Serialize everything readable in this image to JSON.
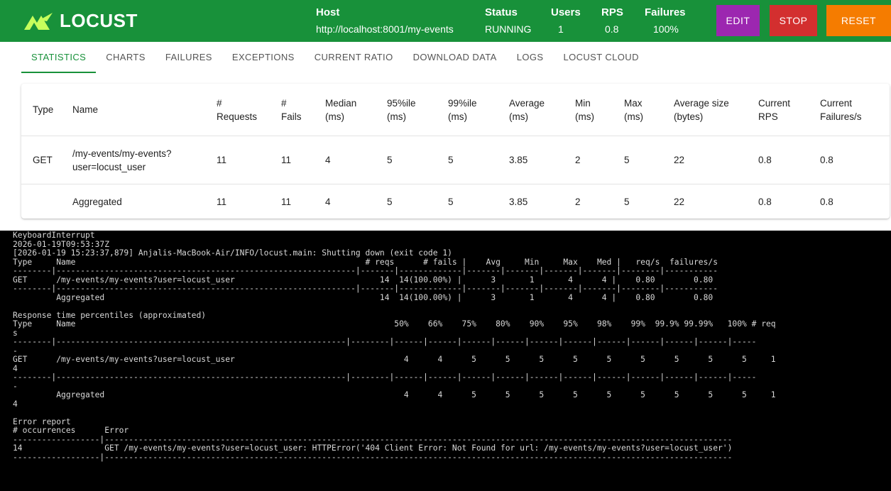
{
  "header": {
    "logo_text": "LOCUST",
    "stats": [
      {
        "label": "Host",
        "value": "http://localhost:8001/my-events"
      },
      {
        "label": "Status",
        "value": "RUNNING"
      },
      {
        "label": "Users",
        "value": "1"
      },
      {
        "label": "RPS",
        "value": "0.8"
      },
      {
        "label": "Failures",
        "value": "100%"
      }
    ],
    "buttons": {
      "edit": {
        "label": "EDIT",
        "color": "#9c27b0"
      },
      "stop": {
        "label": "STOP",
        "color": "#d32f2f"
      },
      "reset": {
        "label": "RESET",
        "color": "#f57c00"
      }
    },
    "brand_color": "#18913a"
  },
  "tabs": [
    {
      "label": "STATISTICS",
      "active": true
    },
    {
      "label": "CHARTS"
    },
    {
      "label": "FAILURES"
    },
    {
      "label": "EXCEPTIONS"
    },
    {
      "label": "CURRENT RATIO"
    },
    {
      "label": "DOWNLOAD DATA"
    },
    {
      "label": "LOGS"
    },
    {
      "label": "LOCUST CLOUD"
    }
  ],
  "stats_table": {
    "columns": [
      "Type",
      "Name",
      "#\nRequests",
      "#\nFails",
      "Median\n(ms)",
      "95%ile\n(ms)",
      "99%ile\n(ms)",
      "Average\n(ms)",
      "Min\n(ms)",
      "Max\n(ms)",
      "Average size\n(bytes)",
      "Current\nRPS",
      "Current\nFailures/s"
    ],
    "rows": [
      [
        "GET",
        "/my-events/my-events?\nuser=locust_user",
        "11",
        "11",
        "4",
        "5",
        "5",
        "3.85",
        "2",
        "5",
        "22",
        "0.8",
        "0.8"
      ],
      [
        "",
        "Aggregated",
        "11",
        "11",
        "4",
        "5",
        "5",
        "3.85",
        "2",
        "5",
        "22",
        "0.8",
        "0.8"
      ]
    ]
  },
  "terminal": {
    "lines": [
      "KeyboardInterrupt",
      "2026-01-19T09:53:37Z",
      "[2026-01-19 15:23:37,879] Anjalis-MacBook-Air/INFO/locust.main: Shutting down (exit code 1)",
      "Type     Name                                                            # reqs      # fails |    Avg     Min     Max    Med |   req/s  failures/s",
      "--------|--------------------------------------------------------------|-------|-------------|-------|-------|-------|-------|--------|-----------",
      "GET      /my-events/my-events?user=locust_user                              14  14(100.00%) |      3       1       4      4 |    0.80        0.80",
      "--------|--------------------------------------------------------------|-------|-------------|-------|-------|-------|-------|--------|-----------",
      "         Aggregated                                                         14  14(100.00%) |      3       1       4      4 |    0.80        0.80",
      "",
      "Response time percentiles (approximated)",
      "Type     Name                                                                  50%    66%    75%    80%    90%    95%    98%    99%  99.9% 99.99%   100% # req",
      "s",
      "--------|------------------------------------------------------------|--------|------|------|------|------|------|------|------|------|------|------|-----",
      "-",
      "GET      /my-events/my-events?user=locust_user                                   4      4      5      5      5      5      5      5      5      5      5     1",
      "4",
      "--------|------------------------------------------------------------|--------|------|------|------|------|------|------|------|------|------|------|-----",
      "-",
      "         Aggregated                                                              4      4      5      5      5      5      5      5      5      5      5     1",
      "4",
      "",
      "Error report",
      "# occurrences      Error",
      "------------------|----------------------------------------------------------------------------------------------------------------------------------",
      "14                 GET /my-events/my-events?user=locust_user: HTTPError('404 Client Error: Not Found for url: /my-events/my-events?user=locust_user')",
      "------------------|----------------------------------------------------------------------------------------------------------------------------------"
    ]
  }
}
